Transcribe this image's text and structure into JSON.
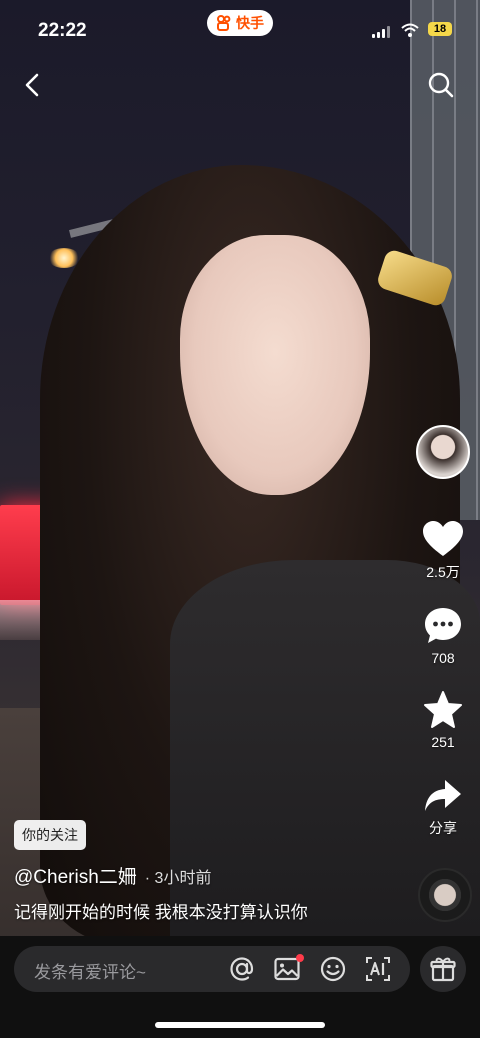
{
  "status_bar": {
    "time": "22:22",
    "app_name": "快手",
    "battery": "18"
  },
  "nav": {
    "back_icon": "back-arrow-icon",
    "search_icon": "search-icon"
  },
  "actions": {
    "like_count": "2.5万",
    "comment_count": "708",
    "favorite_count": "251",
    "share_label": "分享"
  },
  "post": {
    "follow_badge": "你的关注",
    "author": "@Cherish二姍",
    "time_ago": "· 3小时前",
    "caption": "记得刚开始的时候 我根本没打算认识你"
  },
  "comment_bar": {
    "placeholder": "发条有爱评论~",
    "icons": [
      "at-icon",
      "image-icon",
      "emoji-icon",
      "ai-icon",
      "gift-icon"
    ]
  },
  "colors": {
    "brand": "#ff5000",
    "badge_dot": "#ff3b4a"
  }
}
